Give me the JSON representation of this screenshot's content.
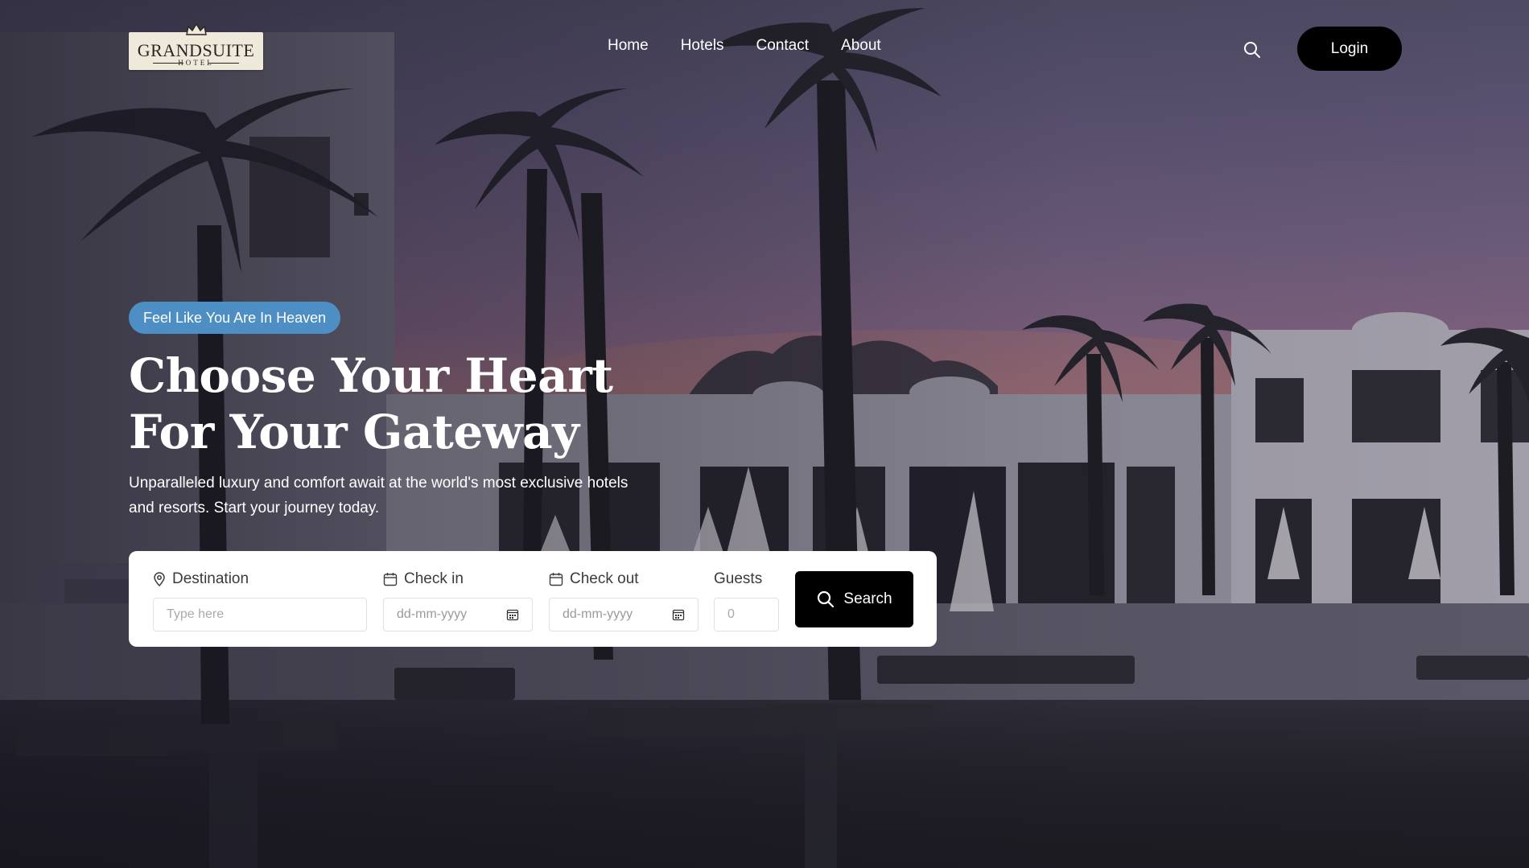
{
  "brand": {
    "name": "GRANDSUITE",
    "tagline": "HOTEL"
  },
  "nav": {
    "items": [
      {
        "label": "Home"
      },
      {
        "label": "Hotels"
      },
      {
        "label": "Contact"
      },
      {
        "label": "About"
      }
    ],
    "login_label": "Login"
  },
  "hero": {
    "badge": "Feel Like You Are In Heaven",
    "title": "Choose Your Heart For Your Gateway",
    "subtitle": "Unparalleled luxury and comfort await at the world's most exclusive hotels and resorts. Start your journey today."
  },
  "booking": {
    "destination_label": "Destination",
    "destination_placeholder": "Type here",
    "checkin_label": "Check in",
    "checkin_placeholder": "dd-mm-yyyy",
    "checkout_label": "Check out",
    "checkout_placeholder": "dd-mm-yyyy",
    "guests_label": "Guests",
    "guests_placeholder": "0",
    "search_label": "Search"
  },
  "colors": {
    "badge": "#4d8fc4",
    "button": "#000000",
    "panel": "#ffffff",
    "logo_bg": "#efe9dc"
  },
  "icons": {
    "header_search": "search-icon",
    "destination": "map-pin-icon",
    "checkin": "calendar-icon",
    "checkout": "calendar-icon",
    "search_button": "search-icon"
  }
}
